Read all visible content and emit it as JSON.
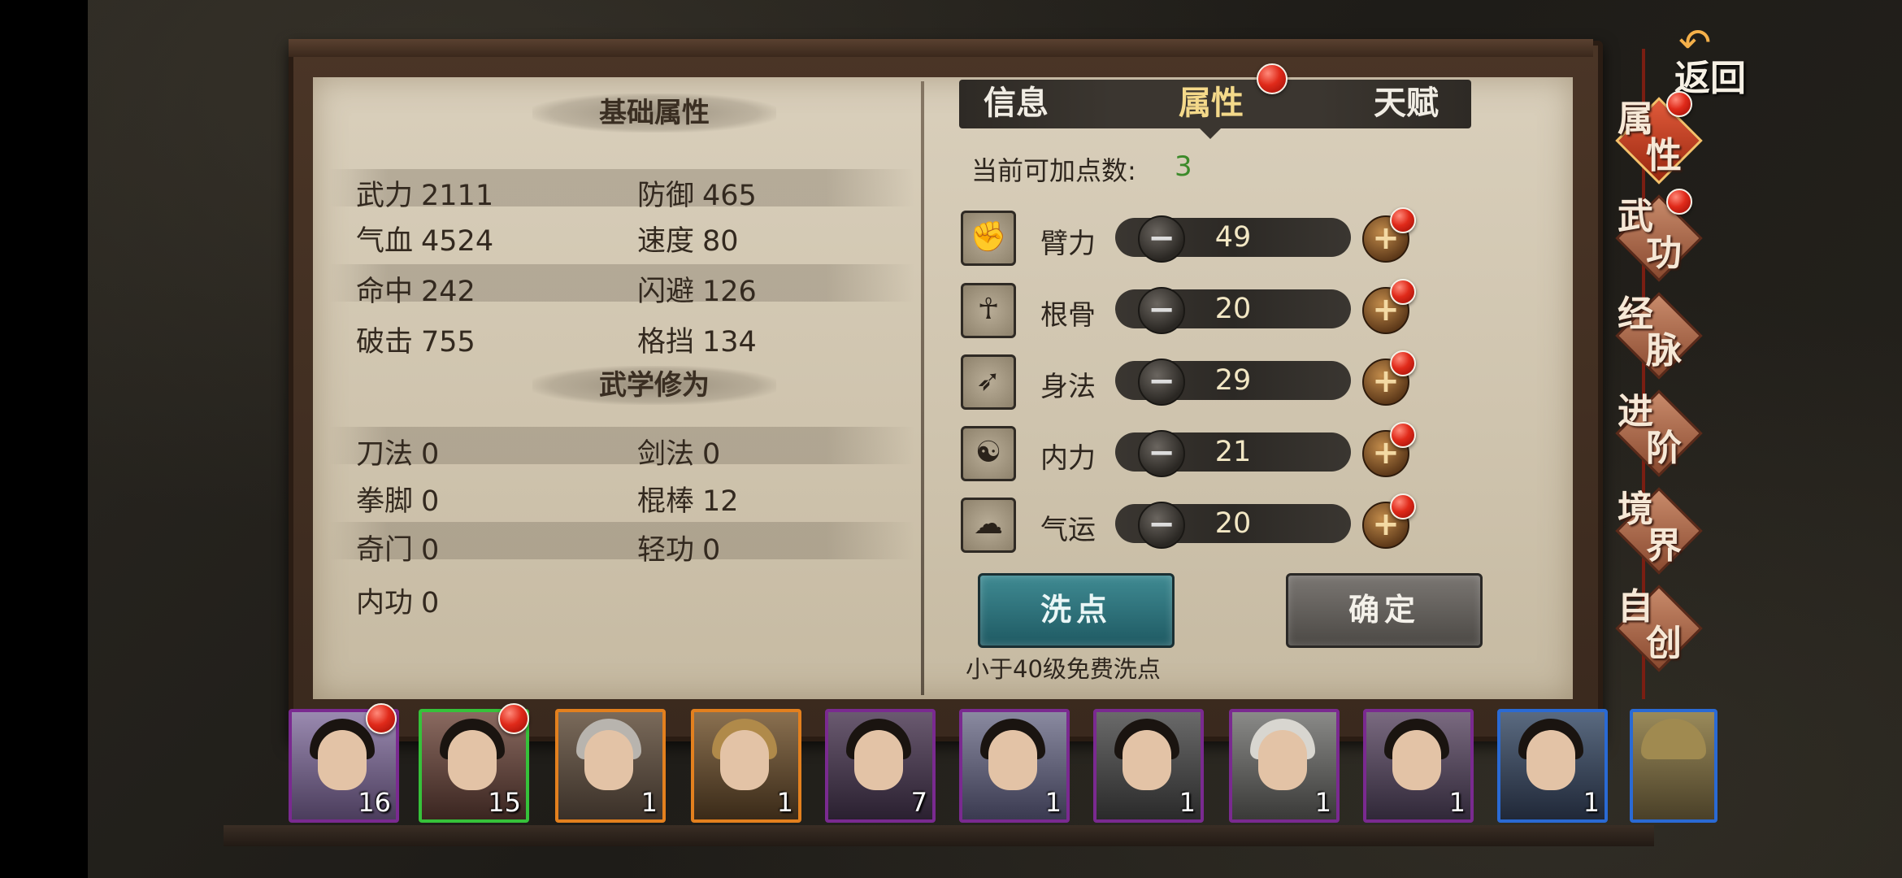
{
  "tabs": {
    "info": "信息",
    "attributes": "属性",
    "talent": "天赋"
  },
  "left": {
    "basic_title": "基础属性",
    "basic_stats": [
      {
        "label": "武力",
        "value": "2111"
      },
      {
        "label": "防御",
        "value": "465"
      },
      {
        "label": "气血",
        "value": "4524"
      },
      {
        "label": "速度",
        "value": "80"
      },
      {
        "label": "命中",
        "value": "242"
      },
      {
        "label": "闪避",
        "value": "126"
      },
      {
        "label": "破击",
        "value": "755"
      },
      {
        "label": "格挡",
        "value": "134"
      }
    ],
    "martial_title": "武学修为",
    "martial_stats": [
      {
        "label": "刀法",
        "value": "0"
      },
      {
        "label": "剑法",
        "value": "0"
      },
      {
        "label": "拳脚",
        "value": "0"
      },
      {
        "label": "棍棒",
        "value": "12"
      },
      {
        "label": "奇门",
        "value": "0"
      },
      {
        "label": "轻功",
        "value": "0"
      },
      {
        "label": "内功",
        "value": "0"
      }
    ]
  },
  "right": {
    "points_label": "当前可加点数:",
    "points_value": "3",
    "attributes": [
      {
        "label": "臂力",
        "value": "49",
        "icon": "arm-strength-icon"
      },
      {
        "label": "根骨",
        "value": "20",
        "icon": "bone-icon"
      },
      {
        "label": "身法",
        "value": "29",
        "icon": "agility-icon"
      },
      {
        "label": "内力",
        "value": "21",
        "icon": "meditation-icon"
      },
      {
        "label": "气运",
        "value": "20",
        "icon": "fortune-cloud-icon"
      }
    ],
    "reset_button": "洗点",
    "confirm_button": "确定",
    "free_note": "小于40级免费洗点"
  },
  "side_menu": {
    "back": "返回",
    "items": [
      {
        "c1": "属",
        "c2": "性"
      },
      {
        "c1": "武",
        "c2": "功"
      },
      {
        "c1": "经",
        "c2": "脉"
      },
      {
        "c1": "进",
        "c2": "阶"
      },
      {
        "c1": "境",
        "c2": "界"
      },
      {
        "c1": "自",
        "c2": "创"
      }
    ]
  },
  "characters": [
    {
      "level": "16"
    },
    {
      "level": "15"
    },
    {
      "level": "1"
    },
    {
      "level": "1"
    },
    {
      "level": "7"
    },
    {
      "level": "1"
    },
    {
      "level": "1"
    },
    {
      "level": "1"
    },
    {
      "level": "1"
    },
    {
      "level": "1"
    },
    {
      "level": ""
    }
  ],
  "colors": {
    "points": "#3c8a2a",
    "active_tab": "#f4d98a",
    "reset_button": "#2f7680"
  }
}
